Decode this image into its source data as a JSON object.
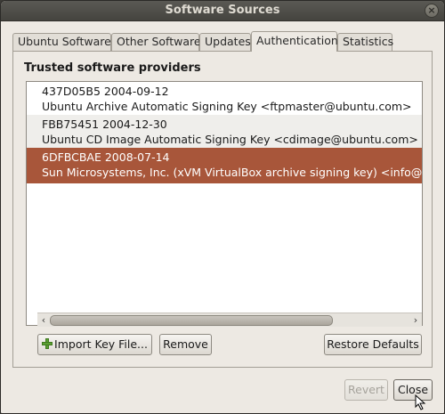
{
  "window": {
    "title": "Software Sources",
    "close_glyph": "×"
  },
  "tabs": [
    {
      "label": "Ubuntu Software"
    },
    {
      "label": "Other Software"
    },
    {
      "label": "Updates"
    },
    {
      "label": "Authentication"
    },
    {
      "label": "Statistics"
    }
  ],
  "active_tab": "Authentication",
  "section_title": "Trusted software providers",
  "keys": [
    {
      "id_date": "437D05B5 2004-09-12",
      "description": "Ubuntu Archive Automatic Signing Key <ftpmaster@ubuntu.com>",
      "selected": false
    },
    {
      "id_date": "FBB75451 2004-12-30",
      "description": "Ubuntu CD Image Automatic Signing Key <cdimage@ubuntu.com>",
      "selected": false
    },
    {
      "id_date": "6DFBCBAE 2008-07-14",
      "description": "Sun Microsystems, Inc. (xVM VirtualBox archive signing key) <info@vi",
      "selected": true
    }
  ],
  "scrollbar": {
    "left_arrow": "‹",
    "right_arrow": "›"
  },
  "buttons": {
    "import_key": "Import Key File...",
    "remove": "Remove",
    "restore_defaults": "Restore Defaults",
    "revert": "Revert",
    "close": "Close"
  },
  "colors": {
    "selection": "#a8563a",
    "titlebar": "#4f4e49",
    "window_bg": "#ede9e3"
  },
  "icons": {
    "import_key_icon": "plus-icon",
    "pointer": "mouse-cursor-icon"
  }
}
